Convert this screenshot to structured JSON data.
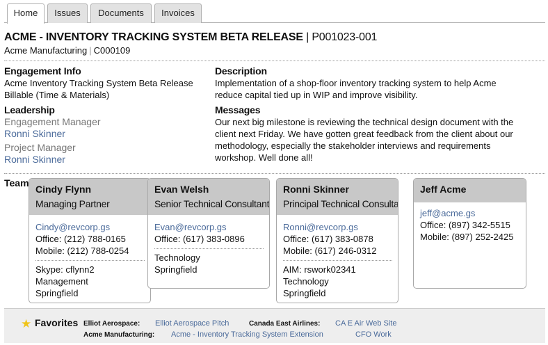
{
  "tabs": [
    {
      "label": "Home",
      "active": true
    },
    {
      "label": "Issues",
      "active": false
    },
    {
      "label": "Documents",
      "active": false
    },
    {
      "label": "Invoices",
      "active": false
    }
  ],
  "project": {
    "title": "ACME - INVENTORY TRACKING SYSTEM BETA RELEASE",
    "separator": "|",
    "code": "P001023-001",
    "client": "Acme Manufacturing",
    "client_code": "C000109"
  },
  "engagement": {
    "heading": "Engagement Info",
    "name": "Acme Inventory Tracking System Beta Release",
    "billing": "Billable (Time & Materials)"
  },
  "leadership": {
    "heading": "Leadership",
    "roles": [
      {
        "title": "Engagement Manager",
        "person": "Ronni Skinner"
      },
      {
        "title": "Project Manager",
        "person": "Ronni Skinner"
      }
    ]
  },
  "description": {
    "heading": "Description",
    "lines": [
      "Implementation of a shop-floor inventory tracking system to help Acme",
      "reduce capital tied up in WIP and improve visibility."
    ]
  },
  "messages": {
    "heading": "Messages",
    "lines": [
      "Our next big milestone is reviewing the technical design document with the",
      "client next Friday. We have gotten great feedback from the client about our",
      "methodology, especially the stakeholder interviews and requirements",
      "workshop. Well done all!"
    ]
  },
  "team": {
    "heading": "Team",
    "members": [
      {
        "name": "Cindy Flynn",
        "role": "Managing Partner",
        "email": "Cindy@revcorp.gs",
        "office": "Office: (212) 788-0165",
        "mobile": "Mobile: (212) 788-0254",
        "extra": [
          "Skype: cflynn2",
          "Management",
          "Springfield"
        ]
      },
      {
        "name": "Evan Welsh",
        "role": "Senior Technical Consultant",
        "email": "Evan@revcorp.gs",
        "office": "Office: (617) 383-0896",
        "mobile": "",
        "extra": [
          "Technology",
          "Springfield"
        ]
      },
      {
        "name": "Ronni Skinner",
        "role": "Principal Technical Consultant",
        "email": "Ronni@revcorp.gs",
        "office": "Office: (617) 383-0878",
        "mobile": "Mobile: (617) 246-0312",
        "extra": [
          "AIM: rswork02341",
          "Technology",
          "Springfield"
        ]
      },
      {
        "name": "Jeff Acme",
        "role": "",
        "email": "jeff@acme.gs",
        "office": "Office: (897) 342-5515",
        "mobile": "Mobile: (897) 252-2425",
        "extra": []
      }
    ]
  },
  "favorites": {
    "title": "Favorites",
    "rows": [
      {
        "client": "Elliot Aerospace:",
        "link": "Elliot Aerospace Pitch",
        "client2": "Canada East Airlines:",
        "link2": "CA E Air Web Site"
      },
      {
        "client": "Acme Manufacturing:",
        "link": "Acme - Inventory Tracking System Extension",
        "link2": "CFO Work"
      }
    ]
  },
  "colors": {
    "link": "#4a6a9a",
    "card_header": "#c8c8c8",
    "favorite_star": "#f0c419"
  }
}
